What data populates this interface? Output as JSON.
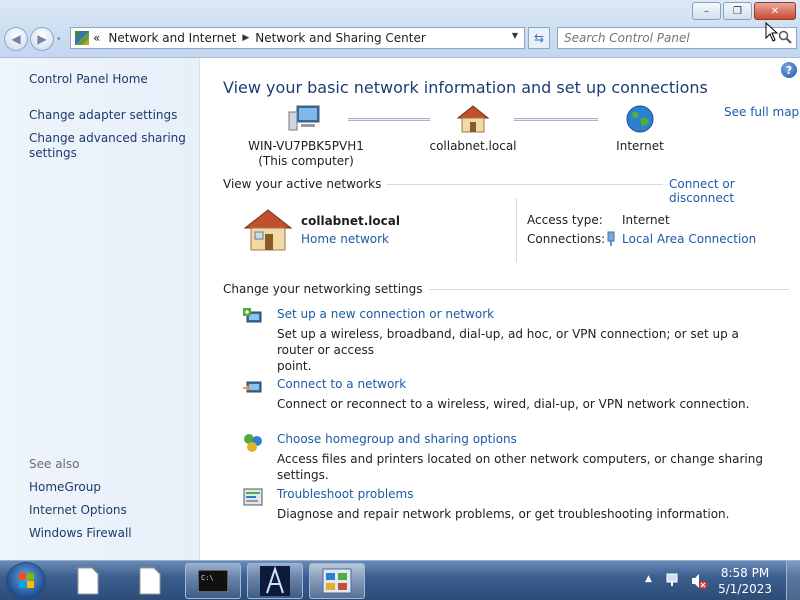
{
  "window": {
    "minimize": "–",
    "maximize": "❐",
    "close": "✕"
  },
  "nav": {
    "back": "◀",
    "forward": "▶",
    "recent": "▾"
  },
  "address": {
    "overflow": "«",
    "segments": [
      "Network and Internet",
      "Network and Sharing Center"
    ],
    "separator": "▶"
  },
  "search": {
    "placeholder": "Search Control Panel"
  },
  "left_pane": {
    "home": "Control Panel Home",
    "adapter": "Change adapter settings",
    "advanced_line1": "Change advanced sharing",
    "advanced_line2": "settings",
    "see_also": "See also",
    "homegroup": "HomeGroup",
    "internet_options": "Internet Options",
    "firewall": "Windows Firewall"
  },
  "main": {
    "help": "?",
    "title": "View your basic network information and set up connections",
    "see_full_map": "See full map",
    "map": {
      "computer_name": "WIN-VU7PBK5PVH1",
      "computer_sub": "(This computer)",
      "network": "collabnet.local",
      "internet": "Internet"
    },
    "active": {
      "section": "View your active networks",
      "connect_disconnect": "Connect or disconnect",
      "name": "collabnet.local",
      "type": "Home network",
      "access_label": "Access type:",
      "access_value": "Internet",
      "connections_label": "Connections:",
      "connections_value": "Local Area Connection"
    },
    "settings": {
      "section": "Change your networking settings",
      "tasks": [
        {
          "title": "Set up a new connection or network",
          "desc1": "Set up a wireless, broadband, dial-up, ad hoc, or VPN connection; or set up a router or access",
          "desc2": "point."
        },
        {
          "title": "Connect to a network",
          "desc1": "Connect or reconnect to a wireless, wired, dial-up, or VPN network connection."
        },
        {
          "title": "Choose homegroup and sharing options",
          "desc1": "Access files and printers located on other network computers, or change sharing settings."
        },
        {
          "title": "Troubleshoot problems",
          "desc1": "Diagnose and repair network problems, or get troubleshooting information."
        }
      ]
    }
  },
  "taskbar": {
    "time": "8:58 PM",
    "date": "5/1/2023",
    "tray_arrow": "▲"
  }
}
